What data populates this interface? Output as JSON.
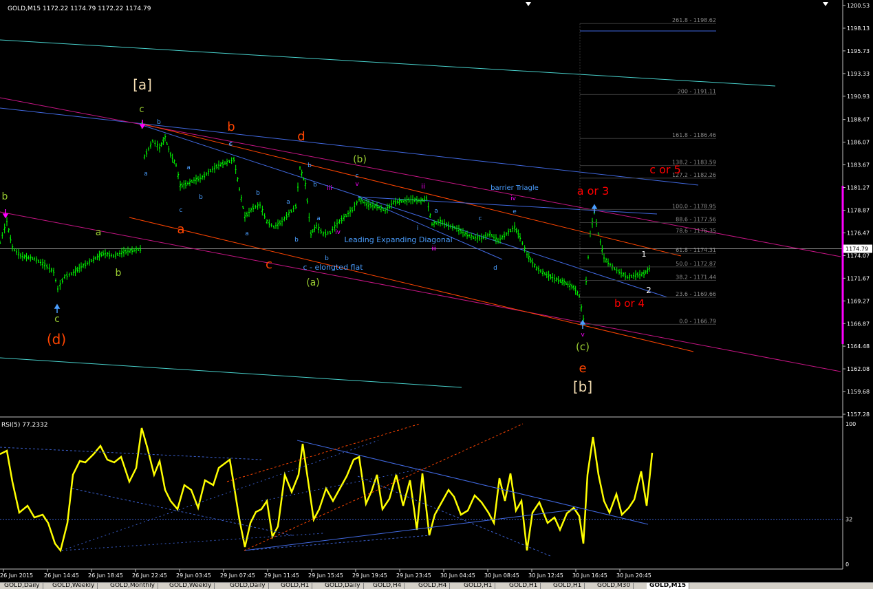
{
  "header": {
    "symbol": "GOLD,M15",
    "ohlc": "1172.22 1174.79 1172.22 1174.79"
  },
  "price_axis": {
    "ticks": [
      "1200.53",
      "1198.13",
      "1195.73",
      "1193.33",
      "1190.93",
      "1188.47",
      "1186.07",
      "1183.67",
      "1181.27",
      "1178.87",
      "1176.47",
      "1174.07",
      "1171.67",
      "1169.27",
      "1166.87",
      "1164.48",
      "1162.08",
      "1159.68",
      "1157.28"
    ],
    "current": "1174.79"
  },
  "time_axis": {
    "ticks": [
      "26 Jun 2015",
      "26 Jun 14:45",
      "26 Jun 18:45",
      "26 Jun 22:45",
      "29 Jun 03:45",
      "29 Jun 07:45",
      "29 Jun 11:45",
      "29 Jun 15:45",
      "29 Jun 19:45",
      "29 Jun 23:45",
      "30 Jun 04:45",
      "30 Jun 08:45",
      "30 Jun 12:45",
      "30 Jun 16:45",
      "30 Jun 20:45"
    ]
  },
  "fib_levels": [
    {
      "label": "261.8 - 1198.62",
      "price": 1198.62
    },
    {
      "label": "200 - 1191.11",
      "price": 1191.11
    },
    {
      "label": "161.8 - 1186.46",
      "price": 1186.46
    },
    {
      "label": "138.2 - 1183.59",
      "price": 1183.59
    },
    {
      "label": "127.2 - 1182.26",
      "price": 1182.26
    },
    {
      "label": "100.0 - 1178.95",
      "price": 1178.95
    },
    {
      "label": "88.6 - 1177.56",
      "price": 1177.56
    },
    {
      "label": "78.6 - 1176.35",
      "price": 1176.35
    },
    {
      "label": "61.8 - 1174.31",
      "price": 1174.31
    },
    {
      "label": "50.0 - 1172.87",
      "price": 1172.87
    },
    {
      "label": "38.2 - 1171.44",
      "price": 1171.44
    },
    {
      "label": "23.6 - 1169.66",
      "price": 1169.66
    },
    {
      "label": "0.0 - 1166.79",
      "price": 1166.79
    }
  ],
  "wave_labels": [
    {
      "text": "[a]",
      "color": "#f5deb3"
    },
    {
      "text": "c",
      "color": "#9acd32"
    },
    {
      "text": "b",
      "color": "#4a9eff"
    },
    {
      "text": "b",
      "color": "#ff4500"
    },
    {
      "text": "d",
      "color": "#ff4500"
    },
    {
      "text": "c",
      "color": "#4a9eff"
    },
    {
      "text": "b",
      "color": "#4a9eff"
    },
    {
      "text": "(b)",
      "color": "#9acd32"
    },
    {
      "text": "c",
      "color": "#4a9eff"
    },
    {
      "text": "v",
      "color": "#ff00ff"
    },
    {
      "text": "ii",
      "color": "#ff00ff"
    },
    {
      "text": "iii",
      "color": "#ff00ff"
    },
    {
      "text": "barrier Triagle",
      "color": "#4a9eff"
    },
    {
      "text": "iv",
      "color": "#ff00ff"
    },
    {
      "text": "a or 3",
      "color": "#ff0000"
    },
    {
      "text": "c or 5",
      "color": "#ff0000"
    },
    {
      "text": "e",
      "color": "#4a9eff"
    },
    {
      "text": "a",
      "color": "#4a9eff"
    },
    {
      "text": "a",
      "color": "#4a9eff"
    },
    {
      "text": "b",
      "color": "#4a9eff"
    },
    {
      "text": "b",
      "color": "#4a9eff"
    },
    {
      "text": "c",
      "color": "#4a9eff"
    },
    {
      "text": "a",
      "color": "#4a9eff"
    },
    {
      "text": "a",
      "color": "#ff4500"
    },
    {
      "text": "b",
      "color": "#4a9eff"
    },
    {
      "text": "a",
      "color": "#4a9eff"
    },
    {
      "text": "b",
      "color": "#9acd32"
    },
    {
      "text": "a",
      "color": "#9acd32"
    },
    {
      "text": "b",
      "color": "#9acd32"
    },
    {
      "text": "c",
      "color": "#4a9eff"
    },
    {
      "text": "a",
      "color": "#4a9eff"
    },
    {
      "text": "b",
      "color": "#4a9eff"
    },
    {
      "text": "c",
      "color": "#ff4500"
    },
    {
      "text": "iv",
      "color": "#ff00ff"
    },
    {
      "text": "i",
      "color": "#4a9eff"
    },
    {
      "text": "a",
      "color": "#4a9eff"
    },
    {
      "text": "b",
      "color": "#4a9eff"
    },
    {
      "text": "c",
      "color": "#4a9eff"
    },
    {
      "text": "Leading Expanding Diagonal",
      "color": "#4a9eff"
    },
    {
      "text": "iii",
      "color": "#ff00ff"
    },
    {
      "text": "c - elongted flat",
      "color": "#4a9eff"
    },
    {
      "text": "d",
      "color": "#4a9eff"
    },
    {
      "text": "(a)",
      "color": "#9acd32"
    },
    {
      "text": "1",
      "color": "#ffffff"
    },
    {
      "text": "2",
      "color": "#ffffff"
    },
    {
      "text": "b or 4",
      "color": "#ff0000"
    },
    {
      "text": "c",
      "color": "#9acd32"
    },
    {
      "text": "(d)",
      "color": "#ff4500"
    },
    {
      "text": "v",
      "color": "#ff00ff"
    },
    {
      "text": "(c)",
      "color": "#9acd32"
    },
    {
      "text": "e",
      "color": "#ff4500"
    },
    {
      "text": "[b]",
      "color": "#f5deb3"
    }
  ],
  "rsi": {
    "label": "RSI(5) 77.2332",
    "ticks": [
      "100",
      "32",
      "0"
    ]
  },
  "chart_data": {
    "type": "line",
    "title": "GOLD,M15",
    "xlabel": "",
    "ylabel": "",
    "ylim": [
      1157.28,
      1200.53
    ],
    "x": [
      "26 Jun 2015",
      "26 Jun 14:45",
      "26 Jun 18:45",
      "26 Jun 22:45",
      "29 Jun 03:45",
      "29 Jun 07:45",
      "29 Jun 11:45",
      "29 Jun 15:45",
      "29 Jun 19:45",
      "29 Jun 23:45",
      "30 Jun 04:45",
      "30 Jun 08:45",
      "30 Jun 12:45",
      "30 Jun 16:45",
      "30 Jun 20:45"
    ],
    "series": [
      {
        "name": "GOLD,M15",
        "values": [
          1174.6,
          1171.5,
          1173.6,
          1186.0,
          1181.5,
          1177.5,
          1179.0,
          1174.8,
          1179.5,
          1179.3,
          1176.5,
          1175.8,
          1169.9,
          1174.5,
          1173.0
        ]
      },
      {
        "name": "RSI(5)",
        "ylim": [
          0,
          100
        ],
        "values": [
          62,
          32,
          55,
          75,
          50,
          20,
          65,
          40,
          58,
          48,
          45,
          52,
          35,
          80,
          77.2332
        ]
      }
    ]
  },
  "bottom_tabs": [
    "GOLD,Daily",
    "GOLD,Weekly",
    "GOLD,Monthly",
    "GOLD,Weekly",
    "GOLD,Daily",
    "GOLD,H1",
    "GOLD,Daily",
    "GOLD,H4",
    "GOLD,H4",
    "GOLD,H1",
    "GOLD,H1",
    "GOLD,H1",
    "GOLD,M30",
    "GOLD,M15"
  ]
}
